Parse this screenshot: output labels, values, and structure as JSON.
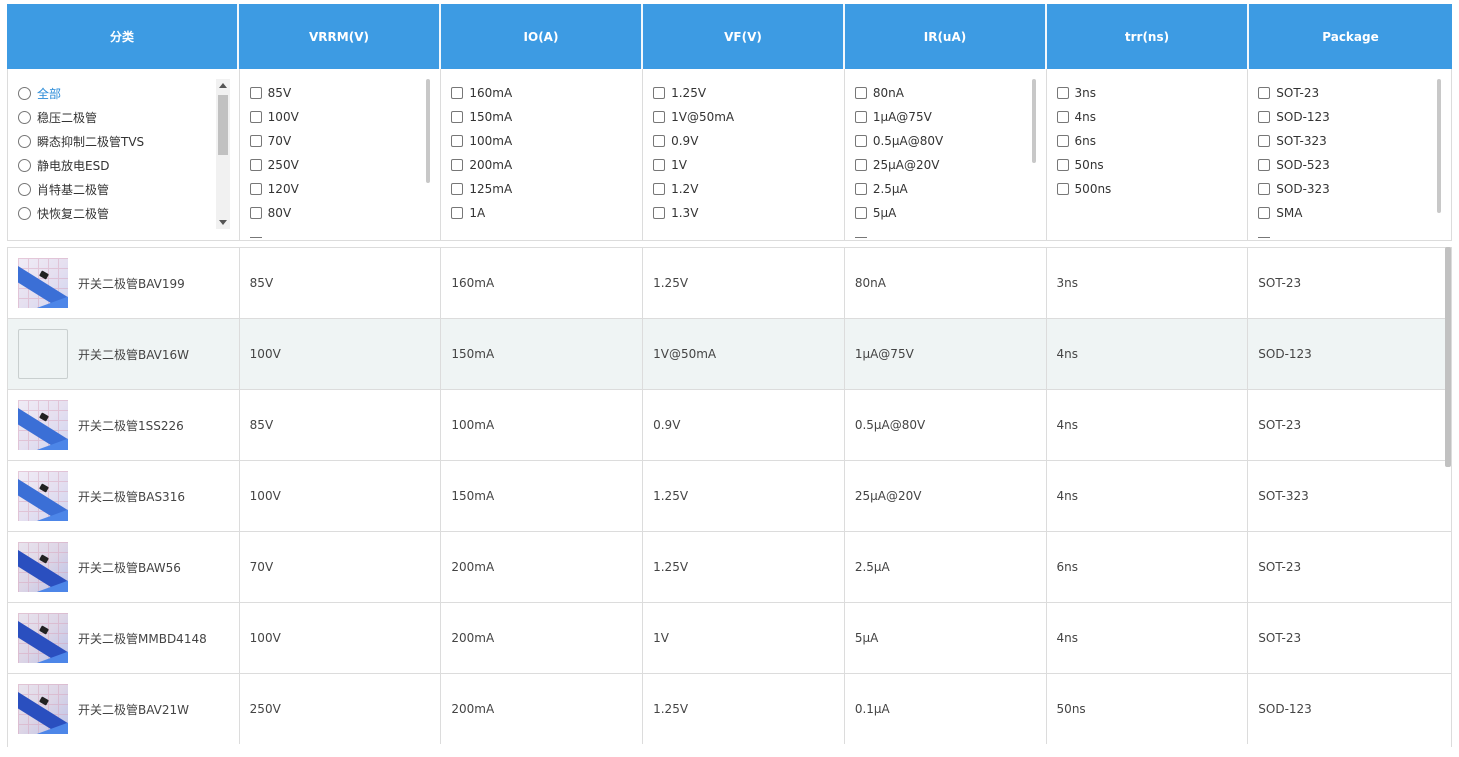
{
  "headers": [
    "分类",
    "VRRM(V)",
    "IO(A)",
    "VF(V)",
    "IR(uA)",
    "trr(ns)",
    "Package"
  ],
  "filters": {
    "category": [
      "全部",
      "稳压二极管",
      "瞬态抑制二极管TVS",
      "静电放电ESD",
      "肖特基二极管",
      "快恢复二极管"
    ],
    "vrrm": [
      "85V",
      "100V",
      "70V",
      "250V",
      "120V",
      "80V"
    ],
    "io": [
      "160mA",
      "150mA",
      "100mA",
      "200mA",
      "125mA",
      "1A"
    ],
    "vf": [
      "1.25V",
      "1V@50mA",
      "0.9V",
      "1V",
      "1.2V",
      "1.3V"
    ],
    "ir": [
      "80nA",
      "1μA@75V",
      "0.5μA@80V",
      "25μA@20V",
      "2.5μA",
      "5μA"
    ],
    "trr": [
      "3ns",
      "4ns",
      "6ns",
      "50ns",
      "500ns"
    ],
    "package": [
      "SOT-23",
      "SOD-123",
      "SOT-323",
      "SOD-523",
      "SOD-323",
      "SMA"
    ]
  },
  "rows": [
    {
      "name": "开关二极管BAV199",
      "vrrm": "85V",
      "io": "160mA",
      "vf": "1.25V",
      "ir": "80nA",
      "trr": "3ns",
      "pkg": "SOT-23"
    },
    {
      "name": "开关二极管BAV16W",
      "vrrm": "100V",
      "io": "150mA",
      "vf": "1V@50mA",
      "ir": "1μA@75V",
      "trr": "4ns",
      "pkg": "SOD-123"
    },
    {
      "name": "开关二极管1SS226",
      "vrrm": "85V",
      "io": "100mA",
      "vf": "0.9V",
      "ir": "0.5μA@80V",
      "trr": "4ns",
      "pkg": "SOT-23"
    },
    {
      "name": "开关二极管BAS316",
      "vrrm": "100V",
      "io": "150mA",
      "vf": "1.25V",
      "ir": "25μA@20V",
      "trr": "4ns",
      "pkg": "SOT-323"
    },
    {
      "name": "开关二极管BAW56",
      "vrrm": "70V",
      "io": "200mA",
      "vf": "1.25V",
      "ir": "2.5μA",
      "trr": "6ns",
      "pkg": "SOT-23"
    },
    {
      "name": "开关二极管MMBD4148",
      "vrrm": "100V",
      "io": "200mA",
      "vf": "1V",
      "ir": "5μA",
      "trr": "4ns",
      "pkg": "SOT-23"
    },
    {
      "name": "开关二极管BAV21W",
      "vrrm": "250V",
      "io": "200mA",
      "vf": "1.25V",
      "ir": "0.1μA",
      "trr": "50ns",
      "pkg": "SOD-123"
    }
  ]
}
